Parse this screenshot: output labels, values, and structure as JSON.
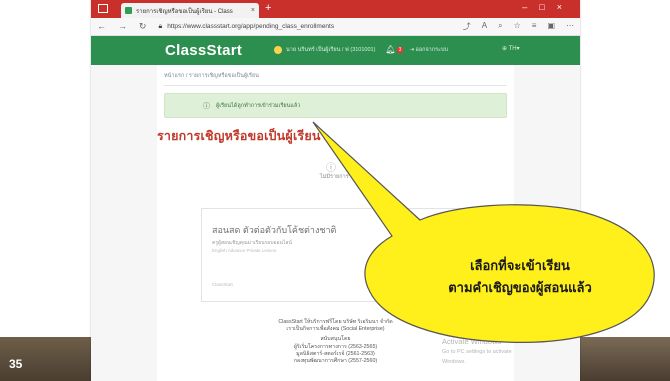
{
  "slide": {
    "number": "35"
  },
  "browser": {
    "tab_title": "รายการเชิญหรือขอเป็นผู้เรียน - Class",
    "url": "https://www.classstart.org/app/pending_class_enrollments"
  },
  "app": {
    "logo_main": "ClassStart",
    "user_text": "นาย นรินทร์ เป็นผู้เรียน / ฟ (3101001)",
    "notification_count": "3",
    "logout_label": "ออกจากระบบ",
    "lang_label": "TH"
  },
  "main": {
    "breadcrumb": "หน้าแรก / รายการเชิญหรือขอเป็นผู้เรียน",
    "alert_text": "ผู้เรียนได้ลูกทำการเข้าร่วมเรียนแล้ว",
    "heading": "รายการเชิญหรือขอเป็นผู้เรียน",
    "empty_text": "ไม่มีรายการ",
    "invite": {
      "title": "สอนสด ตัวต่อตัวกับโค้ชต่างชาติ",
      "line1": "ครูผู้สอนเชิญคุณมาเรียนรอบออนไลน์",
      "line2": "English Advance Private Lesson",
      "footer": "ClassStart"
    },
    "footer_lines": [
      "ClassStart ให้บริการฟรีโดย บริษัท ริเอริมนา จำกัด",
      "เราเป็นกิจการเพื่อสังคม (Social Enterprise)",
      "สนับสนุนโดย",
      "ผู้ริเริ่มโครงการทางการ (2563-2565)",
      "มูลนิธิสตาร์-สตอร์เรจ์ (2561-2563)",
      "กองทุนพัฒนาการศึกษา (2557-2560)"
    ],
    "watermark_title": "Activate Windows",
    "watermark_sub": "Go to PC settings to activate Windows."
  },
  "callout": {
    "line1": "เลือกที่จะเข้าเรียน",
    "line2": "ตามคำเชิญของผู้สอนแล้ว"
  },
  "colors": {
    "brand_green": "#2c8f4f",
    "heading_red": "#c0392b",
    "callout_yellow": "#ffef1a",
    "titlebar_red": "#c9302c"
  }
}
